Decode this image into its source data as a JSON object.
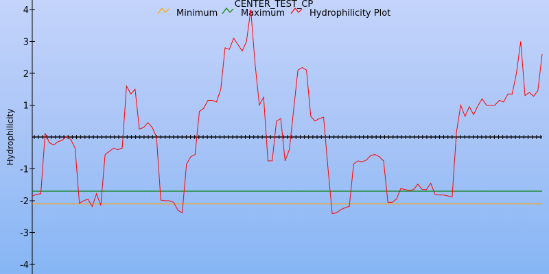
{
  "chart_data": {
    "type": "line",
    "title": "CENTER_TEST_CP",
    "ylabel": "Hydrophilicity",
    "xlabel": "",
    "ylim": [
      -4.3,
      4.3
    ],
    "yticks": [
      {
        "value": 4,
        "label": "4"
      },
      {
        "value": 3,
        "label": "3"
      },
      {
        "value": 2,
        "label": "2"
      },
      {
        "value": 1,
        "label": "1"
      },
      {
        "value": -1,
        "label": "-1"
      },
      {
        "value": -2,
        "label": "-2"
      },
      {
        "value": -3,
        "label": "-3"
      },
      {
        "value": -4,
        "label": "-4"
      }
    ],
    "zero_line": {
      "value": 0,
      "color": "#000000",
      "style": "dashed-ticks"
    },
    "legend_placement": "top-center",
    "series": [
      {
        "name": "Minimum",
        "color": "#ffa500",
        "kind": "hline",
        "value": -2.1
      },
      {
        "name": "Maximum",
        "color": "#008000",
        "kind": "hline",
        "value": -1.7
      },
      {
        "name": "Hydrophilicity Plot",
        "color": "#ff0000",
        "kind": "line",
        "values": [
          -1.85,
          -1.8,
          -1.78,
          0.12,
          -0.18,
          -0.25,
          -0.15,
          -0.1,
          0.02,
          -0.08,
          -0.35,
          -2.08,
          -2.0,
          -1.95,
          -2.18,
          -1.78,
          -2.15,
          -0.55,
          -0.45,
          -0.35,
          -0.4,
          -0.35,
          1.6,
          1.35,
          1.5,
          0.25,
          0.3,
          0.45,
          0.3,
          0.0,
          -1.98,
          -2.0,
          -2.0,
          -2.05,
          -2.3,
          -2.38,
          -0.85,
          -0.62,
          -0.55,
          0.8,
          0.9,
          1.15,
          1.15,
          1.1,
          1.5,
          2.8,
          2.75,
          3.1,
          2.9,
          2.7,
          3.0,
          4.0,
          2.3,
          1.0,
          1.25,
          -0.75,
          -0.75,
          0.5,
          0.58,
          -0.75,
          -0.4,
          0.85,
          2.1,
          2.18,
          2.1,
          0.65,
          0.5,
          0.58,
          0.62,
          -0.95,
          -2.4,
          -2.38,
          -2.28,
          -2.22,
          -2.18,
          -0.85,
          -0.75,
          -0.78,
          -0.72,
          -0.58,
          -0.55,
          -0.62,
          -0.75,
          -2.05,
          -2.05,
          -1.95,
          -1.62,
          -1.65,
          -1.68,
          -1.65,
          -1.48,
          -1.65,
          -1.65,
          -1.45,
          -1.8,
          -1.82,
          -1.82,
          -1.85,
          -1.88,
          0.15,
          1.0,
          0.65,
          0.95,
          0.7,
          0.98,
          1.2,
          1.0,
          1.0,
          1.0,
          1.15,
          1.1,
          1.35,
          1.35,
          2.0,
          3.0,
          1.3,
          1.4,
          1.28,
          1.45,
          2.6
        ]
      }
    ]
  }
}
